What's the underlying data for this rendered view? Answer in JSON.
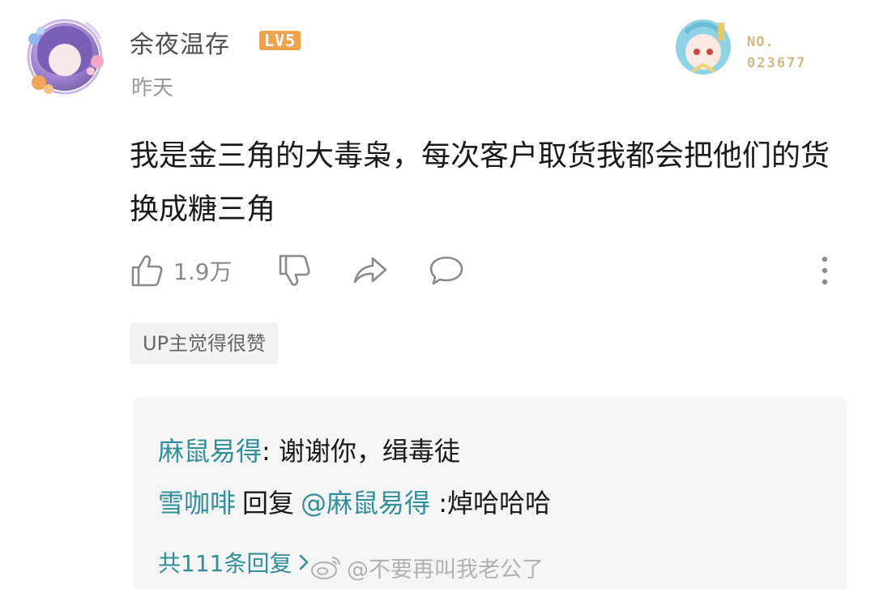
{
  "comment": {
    "username": "余夜温存",
    "level_badge": "LV5",
    "time": "昨天",
    "fan_badge": {
      "label": "NO.",
      "number": "023677"
    },
    "text": "我是金三角的大毒枭，每次客户取货我都会把他们的货换成糖三角",
    "like_count": "1.9万",
    "up_tag": "UP主觉得很赞"
  },
  "replies": {
    "items": [
      {
        "user": "麻鼠易得",
        "separator": ": ",
        "text": "谢谢你，缉毒徒"
      },
      {
        "user": "雪咖啡",
        "verb": "回复",
        "mention": "@麻鼠易得",
        "text": " :焯哈哈哈"
      }
    ],
    "total": "共111条回复"
  },
  "watermark": {
    "text": "@不要再叫我老公了"
  },
  "colors": {
    "accent": "#2f8f9a",
    "level_badge": "#f0a34a",
    "muted": "#9a9a9a",
    "fan_gold": "#d2b887"
  },
  "icons": [
    "like-icon",
    "dislike-icon",
    "share-icon",
    "reply-icon",
    "more-icon",
    "chevron-right-icon",
    "weibo-logo"
  ]
}
